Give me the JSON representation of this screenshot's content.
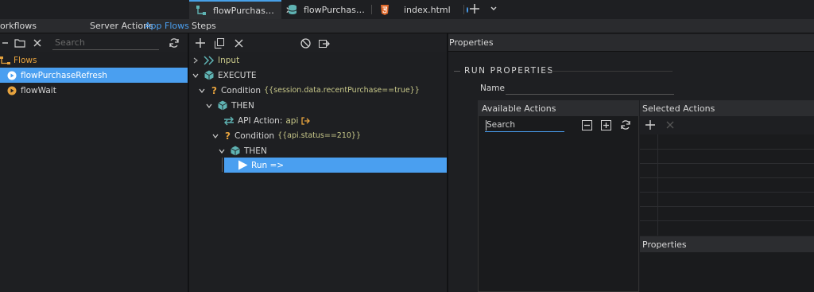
{
  "tabs": [
    {
      "label": "flowPurchas…",
      "active": true
    },
    {
      "label": "flowPurchas…",
      "active": false
    },
    {
      "label": "index.html",
      "active": false
    }
  ],
  "header": {
    "workflows_title": "orkflows",
    "server_actions": "Server Actions",
    "app_flows": "App Flows",
    "steps_title": "Steps"
  },
  "left": {
    "search_placeholder": "Search",
    "flows_label": "Flows",
    "items": [
      {
        "label": "flowPurchaseRefresh",
        "selected": true
      },
      {
        "label": "flowWait",
        "selected": false
      }
    ]
  },
  "steps": {
    "input": "Input",
    "execute": "EXECUTE",
    "condition1_label": "Condition",
    "condition1_expr": "{{session.data.recentPurchase==true}}",
    "then1": "THEN",
    "api_action_label": "API Action:",
    "api_action_name": "api",
    "condition2_label": "Condition",
    "condition2_expr": "{{api.status==210}}",
    "then2": "THEN",
    "run": "Run =>"
  },
  "properties": {
    "title": "Properties",
    "run_properties": "RUN PROPERTIES",
    "name_label": "Name",
    "available_actions": "Available Actions",
    "selected_actions": "Selected Actions",
    "search_value": "Search",
    "sub_properties": "Properties"
  },
  "colors": {
    "accent": "#4a9ff0",
    "expression": "#c9c98a",
    "flow_orange": "#e7a33e",
    "teal": "#5fb3b3"
  }
}
